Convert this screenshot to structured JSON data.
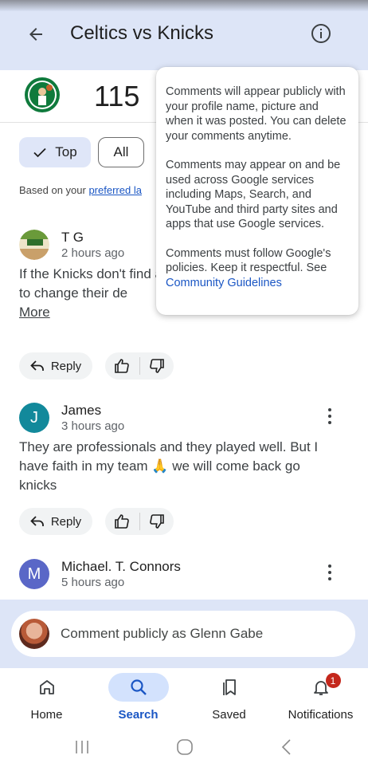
{
  "header": {
    "title": "Celtics vs Knicks",
    "back_icon": "arrow-back-icon",
    "info_icon": "info-icon"
  },
  "scoreboard": {
    "team_logo": "celtics-logo",
    "score": "115"
  },
  "filters": {
    "top_label": "Top",
    "all_label": "All",
    "selected": "Top"
  },
  "language_note": {
    "prefix": "Based on your ",
    "link_text": "preferred la"
  },
  "comments": [
    {
      "name": "T G",
      "time": "2 hours ago",
      "text": "If the Knicks don't find a three point shot they w need to change their de",
      "more": "More",
      "avatar_color": "#7aa63f"
    },
    {
      "name": "James",
      "time": "3 hours ago",
      "text": "They are professionals and they played well. But I have faith in my team 🙏 we will come back go knicks",
      "avatar_letter": "J",
      "avatar_color": "#12899b"
    },
    {
      "name": "Michael. T. Connors",
      "time": "5 hours ago",
      "avatar_letter": "M",
      "avatar_color": "#5a67c7"
    }
  ],
  "actions": {
    "reply_label": "Reply"
  },
  "info_tooltip": {
    "p1": "Comments will appear publicly with your profile name, picture and when it was posted. You can delete your comments anytime.",
    "p2": "Comments may appear on and be used across Google services including Maps, Search, and YouTube and third party sites and apps that use Google services.",
    "p3": "Comments must follow Google's policies. Keep it respectful. See",
    "link": "Community Guidelines"
  },
  "composer": {
    "placeholder": "Comment publicly as Glenn Gabe"
  },
  "bottom_nav": {
    "items": [
      {
        "label": "Home",
        "icon": "home-icon"
      },
      {
        "label": "Search",
        "icon": "search-icon",
        "active": true
      },
      {
        "label": "Saved",
        "icon": "bookmarks-icon"
      },
      {
        "label": "Notifications",
        "icon": "bell-icon",
        "badge": "1"
      }
    ]
  },
  "colors": {
    "appbar_bg": "#dde5f7",
    "accent": "#1a56c4",
    "badge": "#c4271c"
  }
}
